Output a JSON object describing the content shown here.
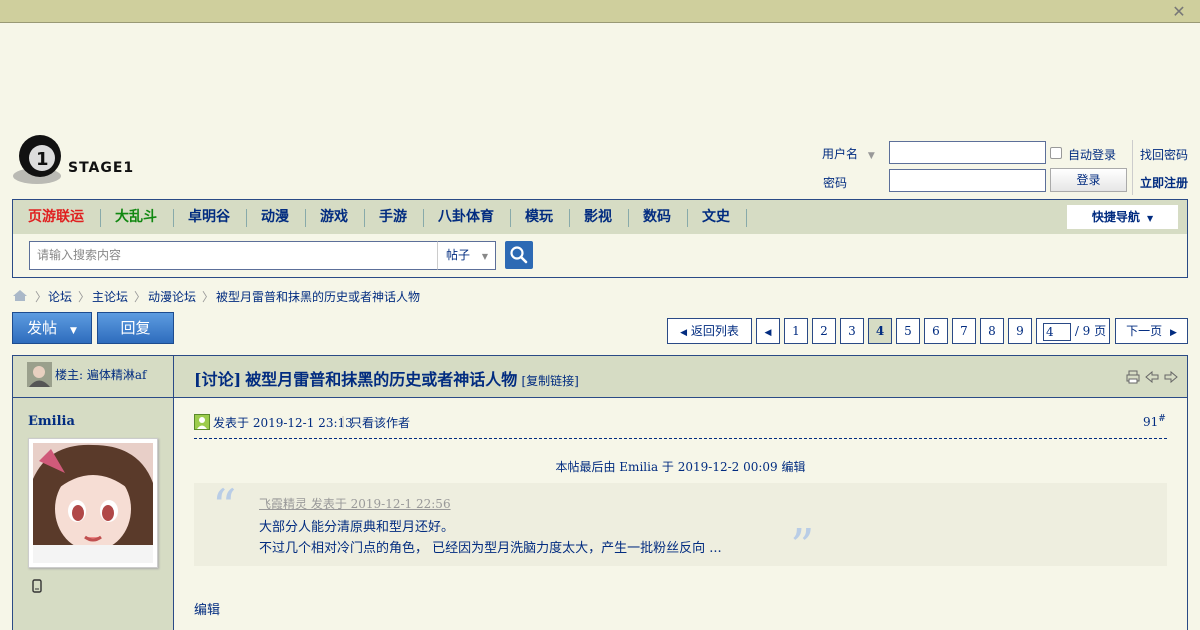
{
  "site": {
    "logo_text": "STAGE1"
  },
  "login": {
    "username_label": "用户名",
    "password_label": "密码",
    "autologin_label": "自动登录",
    "login_button": "登录",
    "forgot_password": "找回密码",
    "register": "立即注册"
  },
  "nav": {
    "items": [
      {
        "label": "页游联运",
        "color": "#e02020"
      },
      {
        "label": "大乱斗",
        "color": "#118811"
      },
      {
        "label": "卓明谷"
      },
      {
        "label": "动漫"
      },
      {
        "label": "游戏"
      },
      {
        "label": "手游"
      },
      {
        "label": "八卦体育"
      },
      {
        "label": "模玩"
      },
      {
        "label": "影视"
      },
      {
        "label": "数码"
      },
      {
        "label": "文史"
      }
    ],
    "quicknav_label": "快捷导航"
  },
  "search": {
    "placeholder": "请输入搜索内容",
    "type_value": "帖子"
  },
  "breadcrumb": [
    "论坛",
    "主论坛",
    "动漫论坛",
    "被型月雷普和抹黑的历史或者神话人物"
  ],
  "actions": {
    "post_button": "发帖",
    "reply_button": "回复"
  },
  "pagination": {
    "back_to_list": "返回列表",
    "pages": [
      "1",
      "2",
      "3",
      "4",
      "5",
      "6",
      "7",
      "8",
      "9"
    ],
    "current_page": "4",
    "page_input_value": "4",
    "total_text": "/ 9 页",
    "next_label": "下一页"
  },
  "thread": {
    "owner_label": "楼主: 遍体精淋af",
    "tag": "[讨论]",
    "title": "被型月雷普和抹黑的历史或者神话人物",
    "copy_link": "[复制链接]"
  },
  "post": {
    "author": "Emilia",
    "posted_at": "发表于 2019-12-1 23:13",
    "only_author": "只看该作者",
    "floor_number": "91",
    "floor_mark": "#",
    "edited_note": "本帖最后由 Emilia 于 2019-12-2 00:09 编辑",
    "quote_source": "飞霞精灵 发表于 2019-12-1 22:56",
    "quote_line1": "大部分人能分清原典和型月还好。",
    "quote_line2": "不过几个相对冷门点的角色， 已经因为型月洗脑力度太大，产生一批粉丝反向 ...",
    "body_text": "编辑"
  },
  "colors": {
    "link_blue": "#022c80",
    "panel_green": "#d6dcc4",
    "button_blue": "#2e6cbd"
  },
  "icons": [
    "close-icon",
    "home-icon",
    "search-icon",
    "print-icon",
    "prev-thread-icon",
    "next-thread-icon",
    "online-status-icon",
    "mobile-icon",
    "quote-open-icon",
    "quote-close-icon"
  ]
}
